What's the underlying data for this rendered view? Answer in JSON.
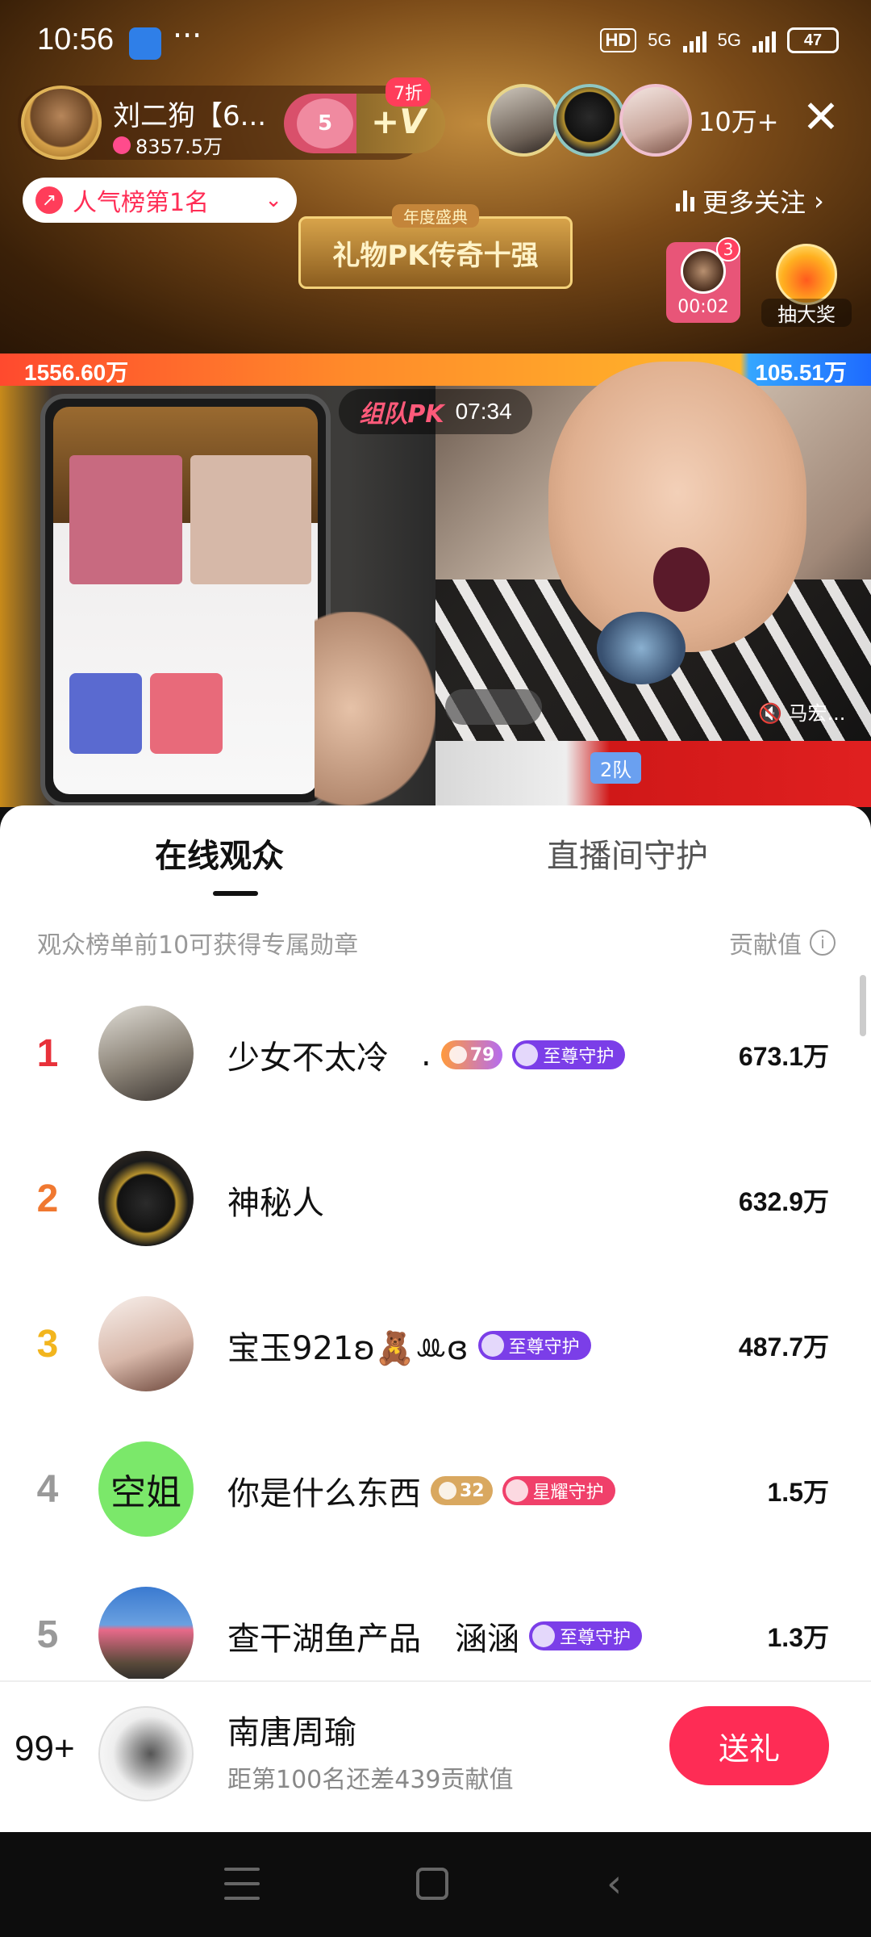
{
  "status_bar": {
    "time": "10:56",
    "dots": "···",
    "hd": "HD",
    "net1": "5G",
    "net2": "5G",
    "battery": "47"
  },
  "host": {
    "name": "刘二狗【6...",
    "fans": "8357.5万",
    "join_level": "5",
    "join_plus": "+V",
    "discount": "7折"
  },
  "viewers": {
    "count": "10万+"
  },
  "rank_pill": {
    "text": "人气榜第1名"
  },
  "banner": {
    "sub": "年度盛典",
    "main": "礼物PK传奇十强"
  },
  "more_follow": {
    "label": "更多关注"
  },
  "timer": {
    "badge": "3",
    "time": "00:02"
  },
  "lottery": {
    "label": "抽大奖"
  },
  "pk_bar": {
    "left_score": "1556.60万",
    "right_score": "105.51万"
  },
  "pk_timer": {
    "logo": "组队PK",
    "time": "07:34"
  },
  "video": {
    "mute_label": "马宏...",
    "team_badge": "2队"
  },
  "sheet": {
    "tabs": [
      {
        "label": "在线观众",
        "active": true
      },
      {
        "label": "直播间守护",
        "active": false
      }
    ],
    "hint_left": "观众榜单前10可获得专属勋章",
    "hint_right": "贡献值",
    "rows": [
      {
        "rank": "1",
        "rank_color": "#e8313a",
        "name": "少女不太冷",
        "suffix": ".",
        "level": "79",
        "level_color": "#f06aa0",
        "guard": "至尊守护",
        "guard_color": "#7b3ee8",
        "value": "673.1万"
      },
      {
        "rank": "2",
        "rank_color": "#f07830",
        "name": "神秘人",
        "suffix": "",
        "level": "",
        "level_color": "",
        "guard": "",
        "guard_color": "",
        "value": "632.9万"
      },
      {
        "rank": "3",
        "rank_color": "#f2b51e",
        "name": "宝玉921ʚ🧸ꔛɞ",
        "suffix": "",
        "level": "",
        "level_color": "",
        "guard": "至尊守护",
        "guard_color": "#7b3ee8",
        "value": "487.7万"
      },
      {
        "rank": "4",
        "rank_color": "#999999",
        "name": "你是什么东西",
        "suffix": "",
        "level": "32",
        "level_color": "#d9a860",
        "guard": "星耀守护",
        "guard_color": "#f0406a",
        "value": "1.5万"
      },
      {
        "rank": "5",
        "rank_color": "#999999",
        "name": "查干湖鱼产品",
        "suffix": "涵涵",
        "level": "",
        "level_color": "",
        "guard": "至尊守护",
        "guard_color": "#7b3ee8",
        "value": "1.3万"
      }
    ],
    "avatar4_text": "空姐"
  },
  "me": {
    "rank": "99+",
    "name": "南唐周瑜",
    "sub": "距第100名还差439贡献值",
    "gift_label": "送礼"
  }
}
